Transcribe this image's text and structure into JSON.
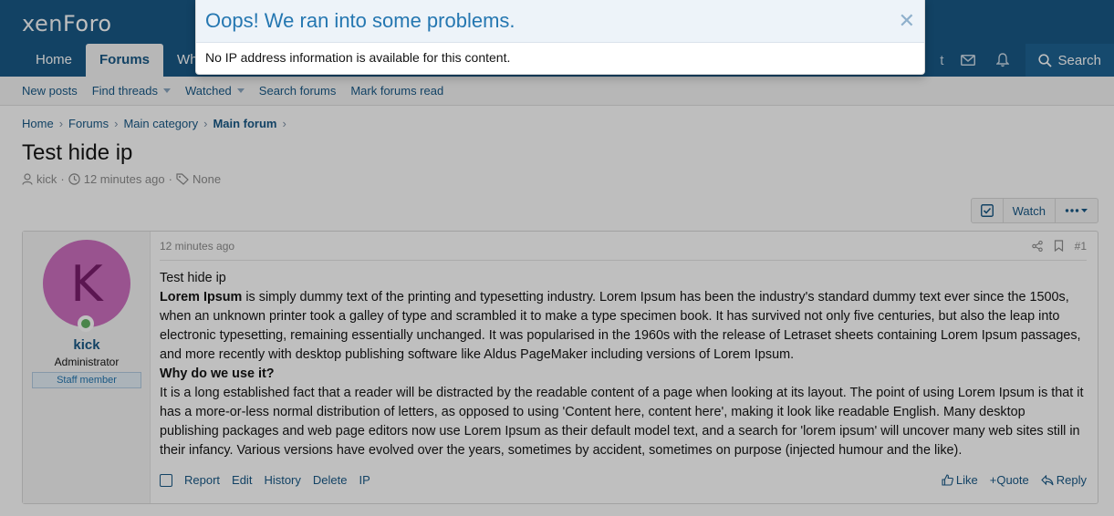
{
  "header": {
    "logo_main": "xen",
    "logo_accent": "Foro",
    "tabs": [
      {
        "label": "Home"
      },
      {
        "label": "Forums"
      },
      {
        "label": "Wh"
      }
    ],
    "partial_right": "t",
    "search_label": "Search"
  },
  "subnav": {
    "items": [
      "New posts",
      "Find threads",
      "Watched",
      "Search forums",
      "Mark forums read"
    ]
  },
  "breadcrumb": [
    "Home",
    "Forums",
    "Main category",
    "Main forum"
  ],
  "thread": {
    "title": "Test hide ip",
    "author": "kick",
    "time": "12 minutes ago",
    "tags": "None"
  },
  "actions": {
    "watch": "Watch"
  },
  "post": {
    "avatar_letter": "K",
    "username": "kick",
    "user_title": "Administrator",
    "banner": "Staff member",
    "time": "12 minutes ago",
    "number": "#1",
    "line1": "Test hide ip",
    "bold1": "Lorem Ipsum",
    "para1": " is simply dummy text of the printing and typesetting industry. Lorem Ipsum has been the industry's standard dummy text ever since the 1500s, when an unknown printer took a galley of type and scrambled it to make a type specimen book. It has survived not only five centuries, but also the leap into electronic typesetting, remaining essentially unchanged. It was popularised in the 1960s with the release of Letraset sheets containing Lorem Ipsum passages, and more recently with desktop publishing software like Aldus PageMaker including versions of Lorem Ipsum.",
    "bold2": "Why do we use it?",
    "para2": "It is a long established fact that a reader will be distracted by the readable content of a page when looking at its layout. The point of using Lorem Ipsum is that it has a more-or-less normal distribution of letters, as opposed to using 'Content here, content here', making it look like readable English. Many desktop publishing packages and web page editors now use Lorem Ipsum as their default model text, and a search for 'lorem ipsum' will uncover many web sites still in their infancy. Various versions have evolved over the years, sometimes by accident, sometimes on purpose (injected humour and the like).",
    "footer_left": [
      "Report",
      "Edit",
      "History",
      "Delete",
      "IP"
    ],
    "like": "Like",
    "quote": "+Quote",
    "reply": "Reply"
  },
  "modal": {
    "title": "Oops! We ran into some problems.",
    "message": "No IP address information is available for this content."
  }
}
